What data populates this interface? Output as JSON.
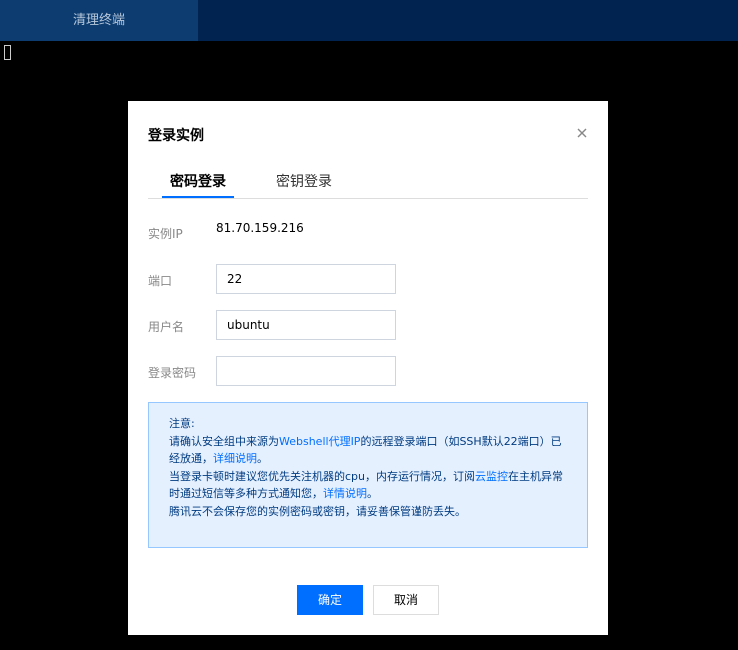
{
  "topbar": {
    "tab_label": "清理终端"
  },
  "dialog": {
    "title": "登录实例",
    "close_icon": "close-icon",
    "tabs": [
      {
        "label": "密码登录",
        "active": true
      },
      {
        "label": "密钥登录",
        "active": false
      }
    ],
    "fields": {
      "ip": {
        "label": "实例IP",
        "value": "81.70.159.216"
      },
      "port": {
        "label": "端口",
        "value": "22",
        "placeholder": ""
      },
      "username": {
        "label": "用户名",
        "value": "ubuntu",
        "placeholder": ""
      },
      "password": {
        "label": "登录密码",
        "value": "",
        "placeholder": ""
      }
    },
    "notice": {
      "heading": "注意:",
      "line1_a": "请确认安全组中来源为",
      "line1_link": "Webshell代理IP",
      "line1_b": "的远程登录端口（如SSH默认22端口）已经放通，",
      "line1_link2": "详细说明",
      "line1_end": "。",
      "line2_a": "当登录卡顿时建议您优先关注机器的cpu，内存运行情况，订阅",
      "line2_link": "云监控",
      "line2_b": "在主机异常时通过短信等多种方式通知您，",
      "line2_link2": "详情说明",
      "line2_end": "。",
      "line3": "腾讯云不会保存您的实例密码或密钥，请妥善保管谨防丢失。"
    },
    "buttons": {
      "confirm": "确定",
      "cancel": "取消"
    }
  },
  "colors": {
    "topbar_bg": "#002350",
    "active_tab_bg": "#0c3c70",
    "primary": "#006eff",
    "notice_bg": "#e5f0ff",
    "notice_border": "#97c7ff"
  }
}
